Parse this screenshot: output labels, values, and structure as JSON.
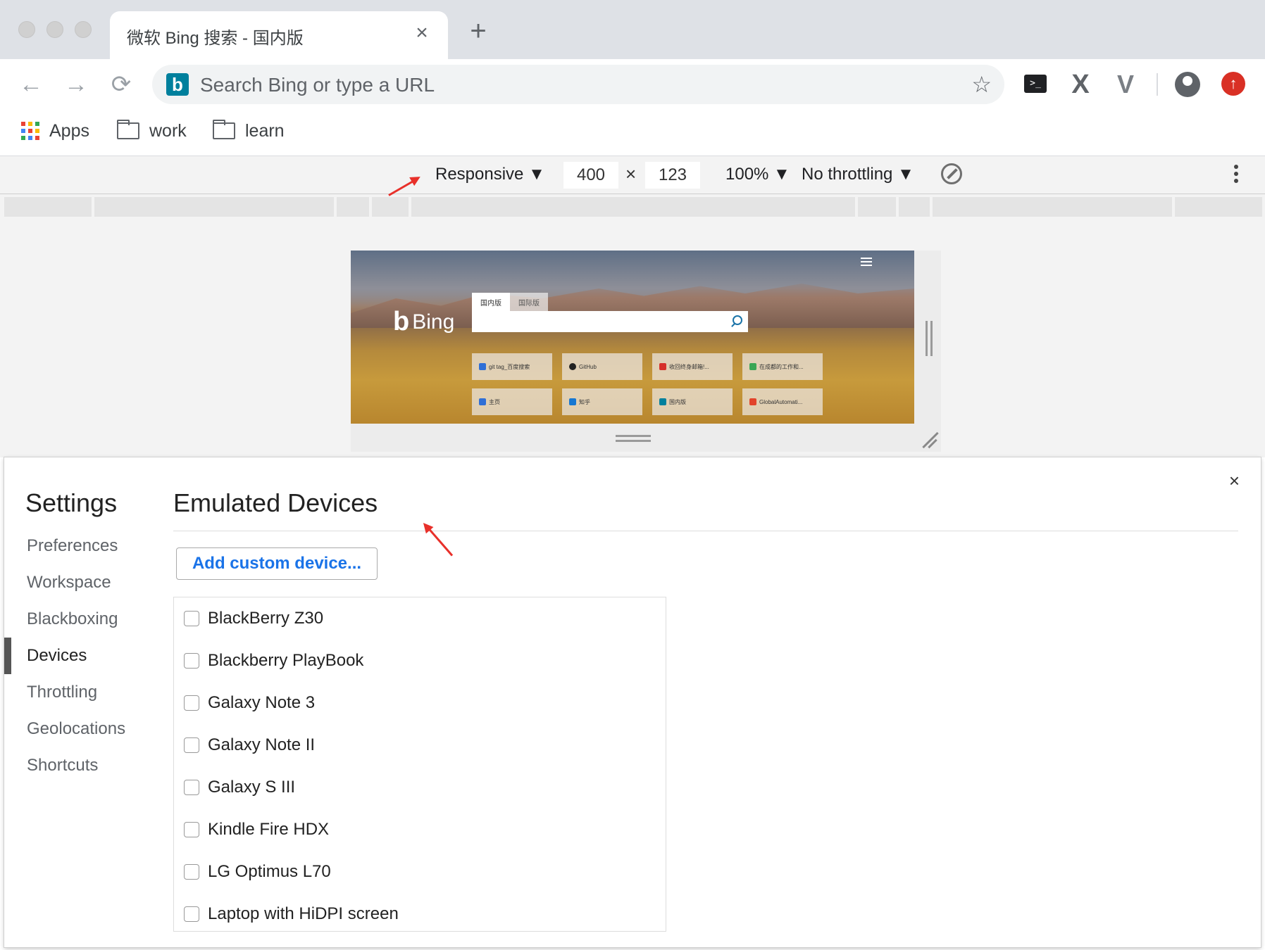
{
  "tab": {
    "title": "微软 Bing 搜索 - 国内版",
    "close": "×",
    "new_tab": "+"
  },
  "toolbar": {
    "back": "←",
    "forward": "→",
    "reload": "⟳",
    "omnibox_placeholder": "Search Bing or type a URL",
    "star": "☆",
    "extensions": [
      "terminal-icon",
      "x-extension-icon",
      "vue-devtools-icon",
      "profile-icon",
      "update-icon"
    ]
  },
  "bookmarks": [
    {
      "label": "Apps",
      "icon": "apps-grid-icon"
    },
    {
      "label": "work",
      "icon": "folder-icon"
    },
    {
      "label": "learn",
      "icon": "folder-icon"
    }
  ],
  "device_toolbar": {
    "device": "Responsive ▼",
    "width": "400",
    "times": "×",
    "height": "123",
    "zoom": "100% ▼",
    "throttling": "No throttling ▼"
  },
  "bing_preview": {
    "logo_text": "Bing",
    "logo_mark": "b",
    "tabs": [
      "国内版",
      "国际版"
    ],
    "quick_links": [
      {
        "label": "git tag_百度搜索",
        "color": "#2f6fd6"
      },
      {
        "label": "GitHub",
        "color": "#222222"
      },
      {
        "label": "收回终身邮箱!...",
        "color": "#d6302a"
      },
      {
        "label": "在成都的工作和...",
        "color": "#3aa655"
      },
      {
        "label": "主页",
        "color": "#2f6fd6"
      },
      {
        "label": "知乎",
        "color": "#1677d2"
      },
      {
        "label": "国内版",
        "color": "#00809d"
      },
      {
        "label": "GlobalAutomati...",
        "color": "#e2432a"
      }
    ]
  },
  "settings": {
    "title": "Settings",
    "close": "×",
    "nav": [
      "Preferences",
      "Workspace",
      "Blackboxing",
      "Devices",
      "Throttling",
      "Geolocations",
      "Shortcuts"
    ],
    "active_nav": "Devices",
    "section_title": "Emulated Devices",
    "add_button": "Add custom device...",
    "devices": [
      "BlackBerry Z30",
      "Blackberry PlayBook",
      "Galaxy Note 3",
      "Galaxy Note II",
      "Galaxy S III",
      "Kindle Fire HDX",
      "LG Optimus L70",
      "Laptop with HiDPI screen"
    ]
  },
  "colors": {
    "accent": "#1a73e8",
    "annotation": "#e8302a",
    "tabstrip": "#dee1e6",
    "devtools_bg": "#f3f3f3"
  }
}
